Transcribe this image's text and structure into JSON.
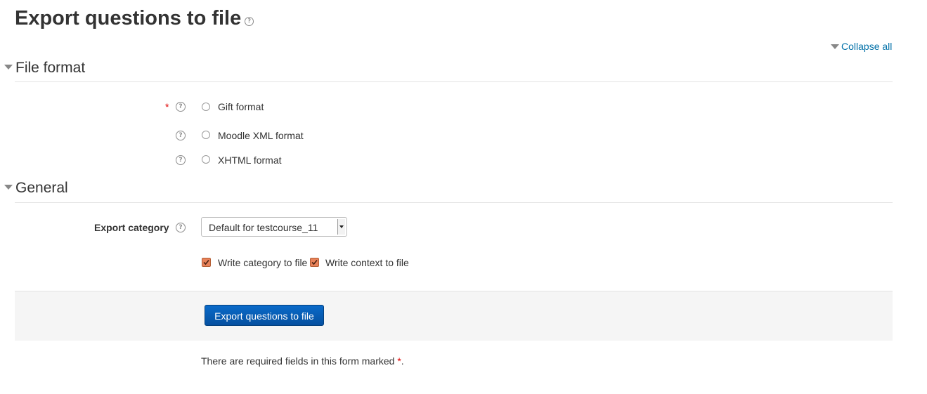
{
  "page": {
    "title": "Export questions to file",
    "collapse_all": "Collapse all"
  },
  "sections": {
    "file_format": {
      "heading": "File format",
      "required_marker": "*",
      "options": [
        {
          "label": "Gift format",
          "selected": false
        },
        {
          "label": "Moodle XML format",
          "selected": false
        },
        {
          "label": "XHTML format",
          "selected": false
        }
      ]
    },
    "general": {
      "heading": "General",
      "export_category_label": "Export category",
      "export_category_value": "Default for testcourse_11",
      "write_category": {
        "label": "Write category to file",
        "checked": true
      },
      "write_context": {
        "label": "Write context to file",
        "checked": true
      }
    }
  },
  "actions": {
    "submit_label": "Export questions to file"
  },
  "footer": {
    "required_note": "There are required fields in this form marked",
    "required_star": "*",
    "required_period": "."
  },
  "colors": {
    "link": "#0070a8",
    "required": "#e00000",
    "button": "#0a6ac9",
    "checkbox": "#e8825a"
  },
  "icons": {
    "help": "question-circle",
    "section_toggle": "triangle-down"
  }
}
